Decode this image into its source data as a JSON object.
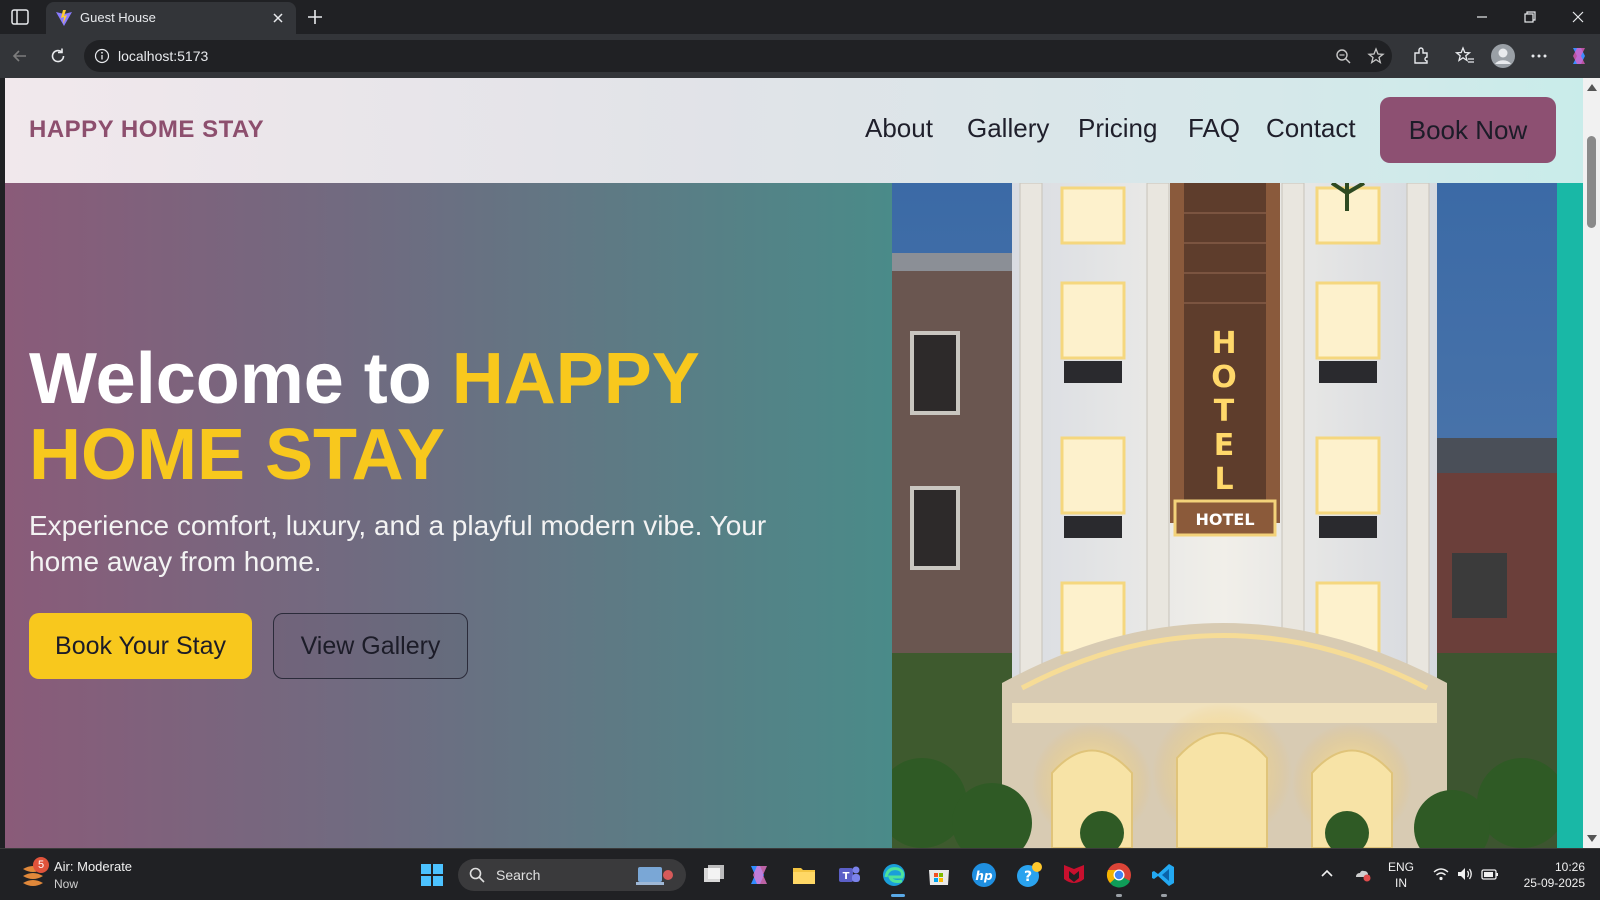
{
  "browser": {
    "tab_title": "Guest House",
    "url": "localhost:5173"
  },
  "site": {
    "brand": "HAPPY HOME STAY",
    "nav": [
      {
        "label": "About"
      },
      {
        "label": "Gallery"
      },
      {
        "label": "Pricing"
      },
      {
        "label": "FAQ"
      },
      {
        "label": "Contact"
      }
    ],
    "cta_label": "Book Now"
  },
  "hero": {
    "title_prefix": "Welcome to ",
    "title_highlight": "HAPPY HOME STAY",
    "subtitle": "Experience comfort, luxury, and a playful modern vibe. Your home away from home.",
    "primary_button": "Book Your Stay",
    "secondary_button": "View Gallery",
    "image_sign_vertical": "HOTEL",
    "image_sign_horizontal": "HOTEL"
  },
  "taskbar": {
    "weather_title": "Air: Moderate",
    "weather_sub": "Now",
    "weather_badge": "5",
    "search_label": "Search",
    "lang_line1": "ENG",
    "lang_line2": "IN",
    "time": "10:26",
    "date": "25-09-2025"
  },
  "colors": {
    "brand": "#8d4f6e",
    "accent_yellow": "#f8c81d",
    "teal": "#19b8a6",
    "cta_purple": "#8d5072"
  }
}
